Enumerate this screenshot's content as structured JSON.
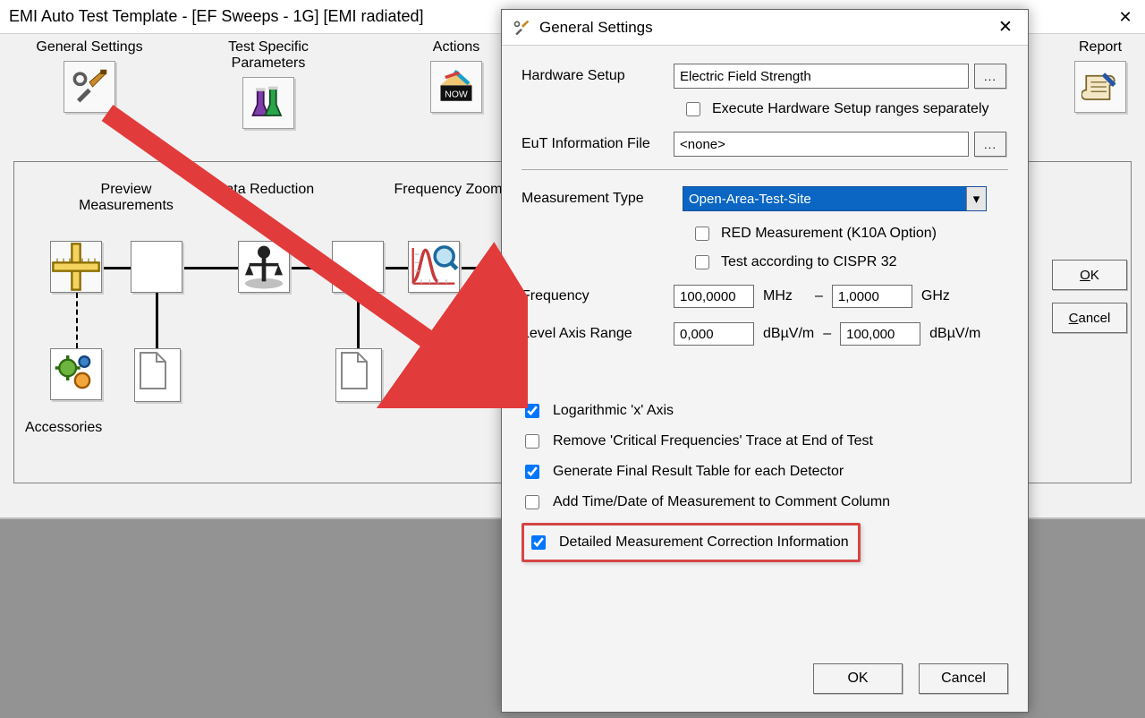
{
  "main": {
    "title": "EMI Auto Test Template - [EF Sweeps - 1G] [EMI radiated]",
    "categories": {
      "general": "General Settings",
      "specific": "Test Specific\nParameters",
      "actions": "Actions",
      "report": "Report"
    },
    "flow": {
      "preview": "Preview\nMeasurements",
      "reduction": "Data Reduction",
      "zoom": "Frequency Zoom",
      "accessories": "Accessories"
    },
    "buttons": {
      "ok": "OK",
      "ok_mn": "O",
      "cancel": "Cancel",
      "cancel_mn": "C"
    }
  },
  "dialog": {
    "title": "General Settings",
    "hw_label": "Hardware Setup",
    "hw_value": "Electric Field Strength",
    "hw_sep": "Execute Hardware Setup ranges separately",
    "eut_label": "EuT Information File",
    "eut_value": "<none>",
    "meas_type_label": "Measurement Type",
    "meas_type_value": "Open-Area-Test-Site",
    "red_opt": "RED Measurement (K10A Option)",
    "cispr": "Test according to CISPR 32",
    "freq_label": "Frequency",
    "freq_from": "100,0000",
    "freq_from_u": "MHz",
    "freq_to": "1,0000",
    "freq_to_u": "GHz",
    "dash": "–",
    "lvl_label": "Level Axis Range",
    "lvl_from": "0,000",
    "lvl_from_u": "dBµV/m",
    "lvl_to": "100,000",
    "lvl_to_u": "dBµV/m",
    "logx": "Logarithmic 'x' Axis",
    "rmcrit": "Remove 'Critical Frequencies' Trace at End of Test",
    "genfin": "Generate Final Result Table for each Detector",
    "addtd": "Add Time/Date of Measurement to Comment Column",
    "detail": "Detailed Measurement Correction Information",
    "ok": "OK",
    "cancel": "Cancel"
  }
}
